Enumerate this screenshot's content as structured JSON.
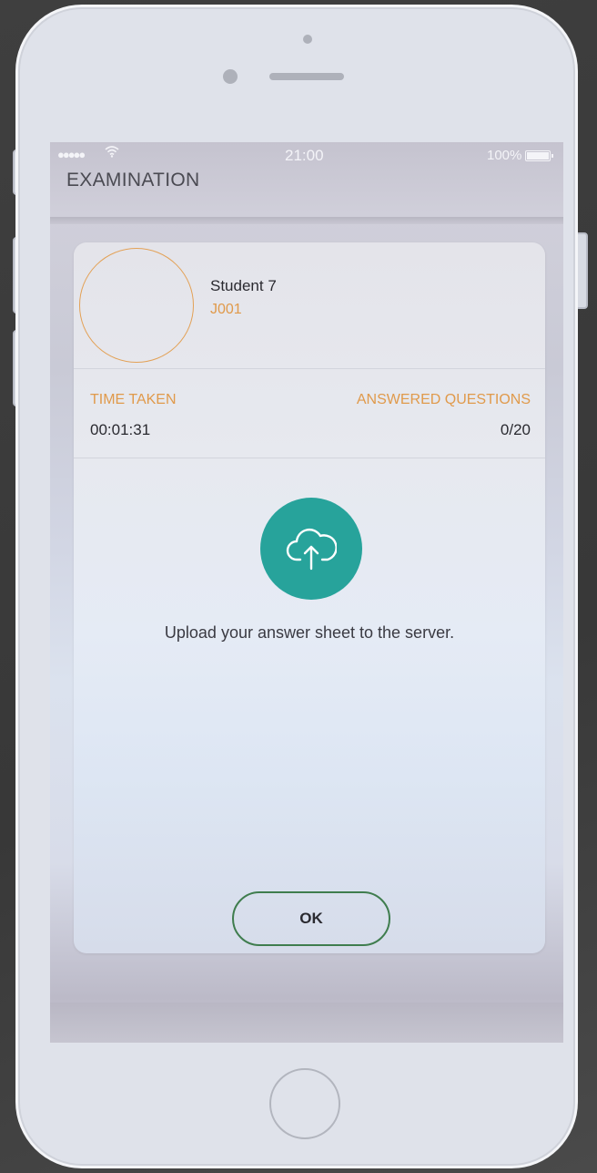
{
  "status_bar": {
    "signal": "●●●●●",
    "time": "21:00",
    "battery": "100%"
  },
  "header": {
    "title": "EXAMINATION"
  },
  "student": {
    "name": "Student 7",
    "id": "J001"
  },
  "stats": {
    "time_taken_label": "TIME TAKEN",
    "time_taken_value": "00:01:31",
    "answered_label": "ANSWERED QUESTIONS",
    "answered_value": "0/20"
  },
  "upload": {
    "message": "Upload your answer sheet to the server.",
    "icon": "cloud-upload-icon",
    "color": "#27a39b"
  },
  "actions": {
    "ok_label": "OK"
  },
  "colors": {
    "accent_orange": "#e09a4b",
    "teal": "#27a39b",
    "button_border": "#3f7d4e"
  }
}
